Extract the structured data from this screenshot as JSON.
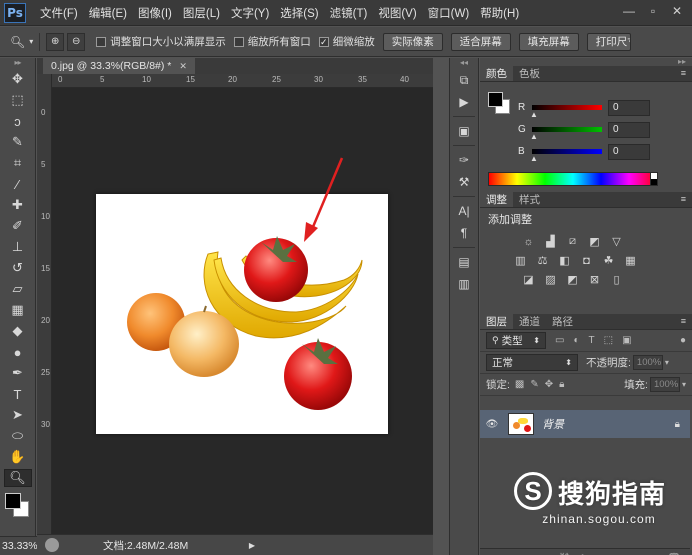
{
  "app": {
    "logo": "Ps",
    "menu": [
      "文件(F)",
      "编辑(E)",
      "图像(I)",
      "图层(L)",
      "文字(Y)",
      "选择(S)",
      "滤镜(T)",
      "视图(V)",
      "窗口(W)",
      "帮助(H)"
    ]
  },
  "window_controls": {
    "minimize": "—",
    "restore": "▫",
    "close": "✕"
  },
  "options": {
    "resize_windows_label": "调整窗口大小以满屏显示",
    "resize_windows_checked": false,
    "zoom_all_label": "缩放所有窗口",
    "zoom_all_checked": false,
    "scrubby_zoom_label": "细微缩放",
    "scrubby_zoom_checked": true,
    "actual_pixels": "实际像素",
    "fit_screen": "适合屏幕",
    "fill_screen": "填充屏幕",
    "print_size": "打印尺寸"
  },
  "document": {
    "tab_title": "0.jpg @ 33.3%(RGB/8#) *",
    "close_icon": "✕"
  },
  "rulers": {
    "h_ticks": [
      "0",
      "5",
      "10",
      "15",
      "20",
      "25",
      "30",
      "35",
      "40"
    ],
    "v_ticks": [
      "0",
      "5",
      "10",
      "15",
      "20",
      "25",
      "30"
    ]
  },
  "status": {
    "zoom": "33.33%",
    "doc_info": "文档:2.48M/2.48M"
  },
  "color_panel": {
    "tabs": [
      "颜色",
      "色板"
    ],
    "channels": [
      {
        "name": "R",
        "value": "0",
        "color": "#ff0000"
      },
      {
        "name": "G",
        "value": "0",
        "color": "#00c000"
      },
      {
        "name": "B",
        "value": "0",
        "color": "#0000ff"
      }
    ],
    "foreground": "#000000",
    "background": "#ffffff"
  },
  "adjustments_panel": {
    "tabs": [
      "调整",
      "样式"
    ],
    "title": "添加调整",
    "rows": [
      [
        "sun-icon",
        "levels-icon",
        "curves-icon",
        "exposure-icon",
        "triangle-icon"
      ],
      [
        "hue-icon",
        "balance-icon",
        "bw-icon",
        "camera-icon",
        "mixer-icon",
        "lookup-icon"
      ],
      [
        "invert-icon",
        "posterize-icon",
        "threshold-icon",
        "selective-icon",
        "gradient-icon"
      ]
    ]
  },
  "layers_panel": {
    "tabs": [
      "图层",
      "通道",
      "路径"
    ],
    "filter_kind": "类型",
    "blend_mode": "正常",
    "opacity_label": "不透明度:",
    "opacity_value": "100%",
    "lock_label": "锁定:",
    "fill_label": "填充:",
    "fill_value": "100%",
    "layer_name": "背景"
  },
  "watermark": {
    "logo": "S",
    "brand": "搜狗指南",
    "url": "zhinan.sogou.com"
  }
}
